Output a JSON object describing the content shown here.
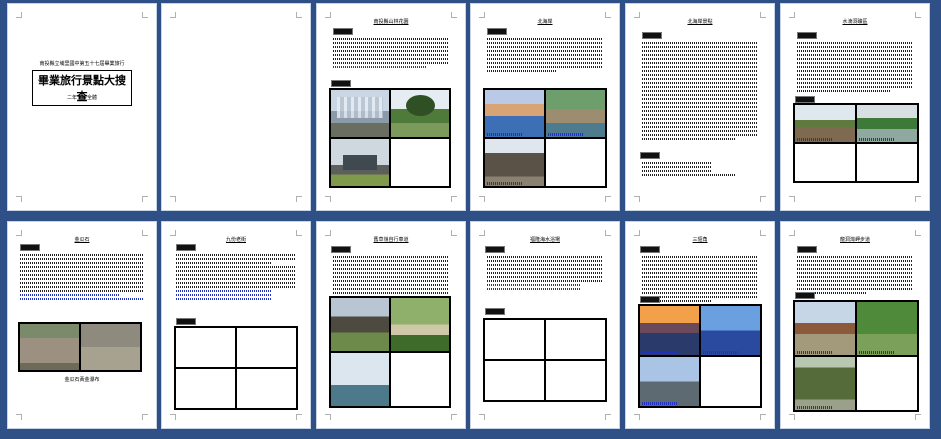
{
  "pages": [
    {
      "id": "p1",
      "cover": {
        "subtitle": "南投縣立埔里國中第五十七屆畢業旅行",
        "title": "畢業旅行景點大搜查",
        "author": "二年五班全體"
      }
    },
    {
      "id": "p2"
    },
    {
      "id": "p3",
      "title": "南投縣山林花園"
    },
    {
      "id": "p4",
      "title": "北海岸"
    },
    {
      "id": "p5",
      "title": "北海岸景點"
    },
    {
      "id": "p6",
      "title": "水湳洞礦區"
    },
    {
      "id": "p7",
      "title": "金瓜石",
      "footnote": "金瓜石黃金瀑布"
    },
    {
      "id": "p8",
      "title": "九份老街"
    },
    {
      "id": "p9",
      "title": "舊草嶺自行車道"
    },
    {
      "id": "p10",
      "title": "福隆海水浴場"
    },
    {
      "id": "p11",
      "title": "三貂角"
    },
    {
      "id": "p12",
      "title": "龍洞灣岬步道"
    }
  ]
}
